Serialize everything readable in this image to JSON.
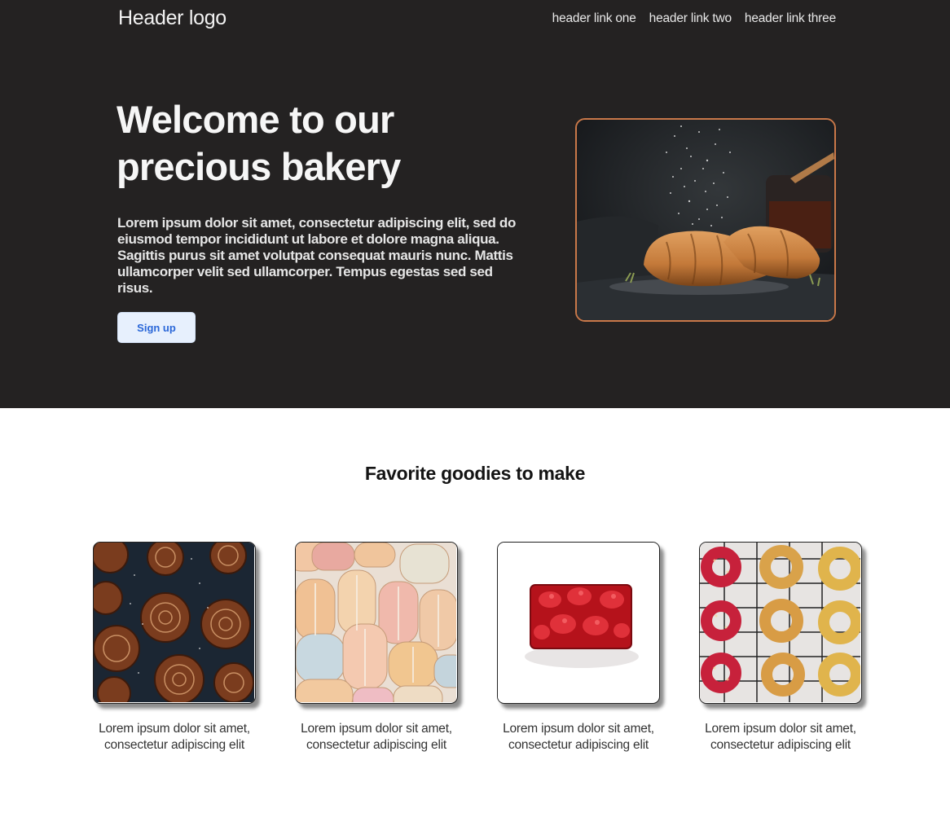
{
  "header": {
    "logo": "Header logo",
    "links": [
      "header link one",
      "header link two",
      "header link three"
    ]
  },
  "hero": {
    "title_line1": "Welcome to our",
    "title_line2": "precious bakery",
    "text": "Lorem ipsum dolor sit amet, consectetur adipiscing elit, sed do eiusmod tempor incididunt ut labore et dolore magna aliqua. Sagittis purus sit amet volutpat consequat mauris nunc. Mattis ullamcorper velit sed ullamcorper. Tempus egestas sed sed risus.",
    "button_label": "Sign up"
  },
  "goodies": {
    "title": "Favorite goodies to make",
    "items": [
      {
        "caption": "Lorem ipsum dolor sit amet, consectetur adipiscing elit"
      },
      {
        "caption": "Lorem ipsum dolor sit amet, consectetur adipiscing elit"
      },
      {
        "caption": "Lorem ipsum dolor sit amet, consectetur adipiscing elit"
      },
      {
        "caption": "Lorem ipsum dolor sit amet, consectetur adipiscing elit"
      }
    ]
  },
  "colors": {
    "hero_background": "#242222",
    "image_border": "#c97849",
    "button_background": "#e7f0fd",
    "button_text": "#2a67d8"
  }
}
